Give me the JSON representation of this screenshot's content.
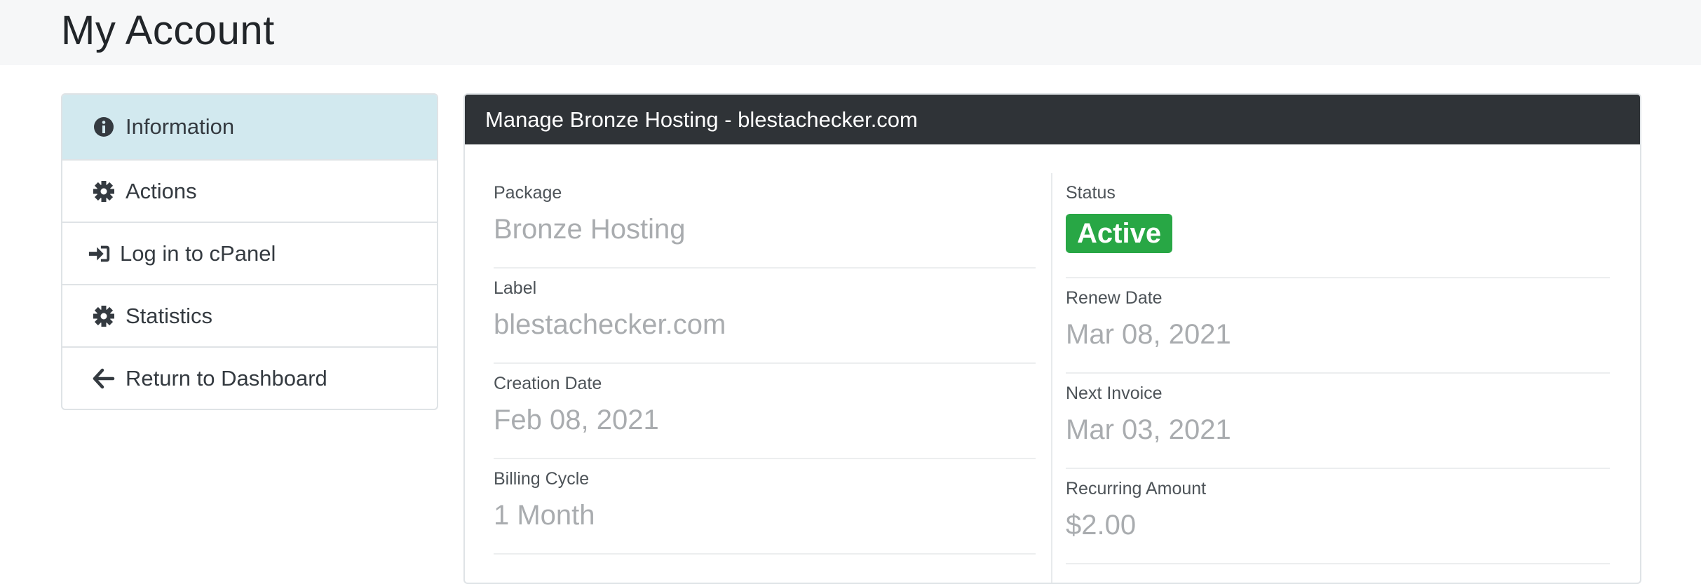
{
  "page": {
    "title": "My Account"
  },
  "sidebar": {
    "items": [
      {
        "label": "Information",
        "icon": "info-circle-icon",
        "active": true
      },
      {
        "label": "Actions",
        "icon": "gear-icon",
        "active": false
      },
      {
        "label": "Log in to cPanel",
        "icon": "sign-in-icon",
        "active": false
      },
      {
        "label": "Statistics",
        "icon": "gear-icon",
        "active": false
      },
      {
        "label": "Return to Dashboard",
        "icon": "arrow-left-icon",
        "active": false
      }
    ]
  },
  "panel": {
    "title": "Manage Bronze Hosting - blestachecker.com",
    "left": [
      {
        "label": "Package",
        "value": "Bronze Hosting"
      },
      {
        "label": "Label",
        "value": "blestachecker.com"
      },
      {
        "label": "Creation Date",
        "value": "Feb 08, 2021"
      },
      {
        "label": "Billing Cycle",
        "value": "1 Month"
      }
    ],
    "right": {
      "status_label": "Status",
      "status_value": "Active",
      "fields": [
        {
          "label": "Renew Date",
          "value": "Mar 08, 2021"
        },
        {
          "label": "Next Invoice",
          "value": "Mar 03, 2021"
        },
        {
          "label": "Recurring Amount",
          "value": "$2.00"
        }
      ]
    }
  },
  "colors": {
    "header_bg": "#2f3337",
    "active_item_bg": "#d2e9ef",
    "status_badge": "#28a745",
    "value_text": "#a9acaf"
  }
}
